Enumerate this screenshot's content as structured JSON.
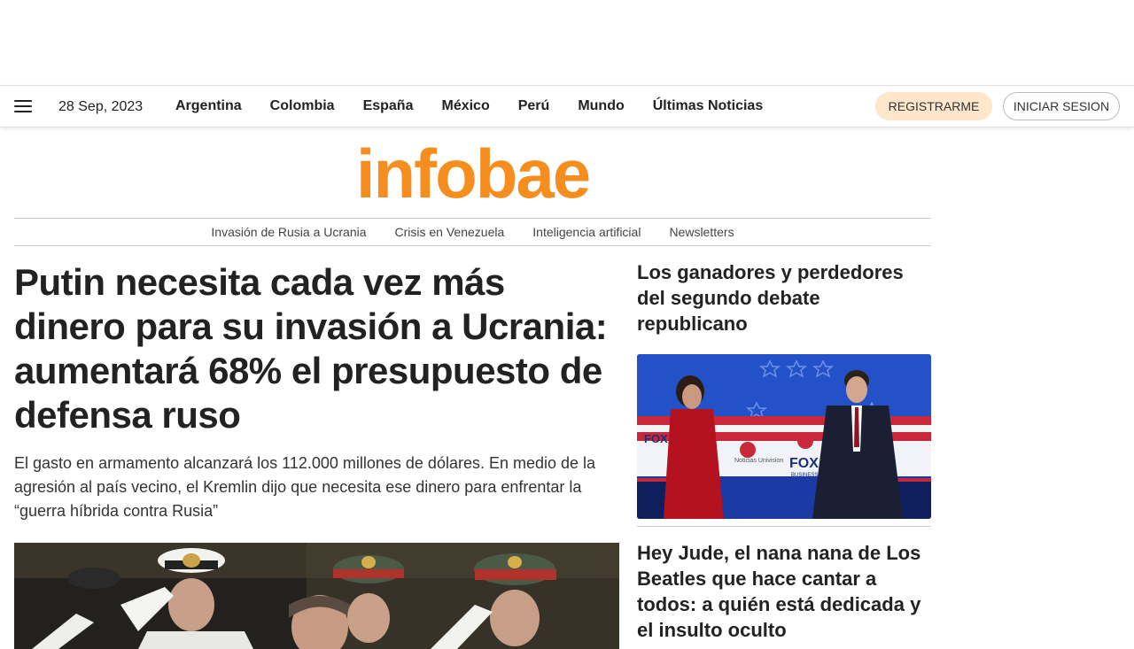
{
  "header": {
    "date": "28 Sep, 2023",
    "nav": [
      "Argentina",
      "Colombia",
      "España",
      "México",
      "Perú",
      "Mundo",
      "Últimas Noticias"
    ],
    "register_label": "REGISTRARME",
    "login_label": "INICIAR SESION",
    "menu_icon": "hamburger-menu-icon"
  },
  "brand": {
    "logo_text": "infobae",
    "logo_color": "#f68e1f"
  },
  "subnav": [
    "Invasión de Rusia a Ucrania",
    "Crisis en Venezuela",
    "Inteligencia artificial",
    "Newsletters"
  ],
  "main_story": {
    "headline": "Putin necesita cada vez más dinero para su invasión a Ucrania: aumentará 68% el presupuesto de defensa ruso",
    "summary": "El gasto en armamento alcanzará los 112.000 millones de dólares. En medio de la agresión al país vecino, el Kremlin dijo que necesita ese dinero para enfrentar la “guerra híbrida contra Rusia”"
  },
  "side_stories": [
    {
      "headline": "Los ganadores y perdedores del segundo debate republicano"
    },
    {
      "headline": "Hey Jude, el nana nana de Los Beatles que hace cantar a todos: a quién está dedicada y el insulto oculto"
    }
  ],
  "debate_image_text": {
    "network_1": "FOX",
    "network_2": "Noticias Univision",
    "network_3": "FOX",
    "network_3_sub": "BUSINESS"
  }
}
